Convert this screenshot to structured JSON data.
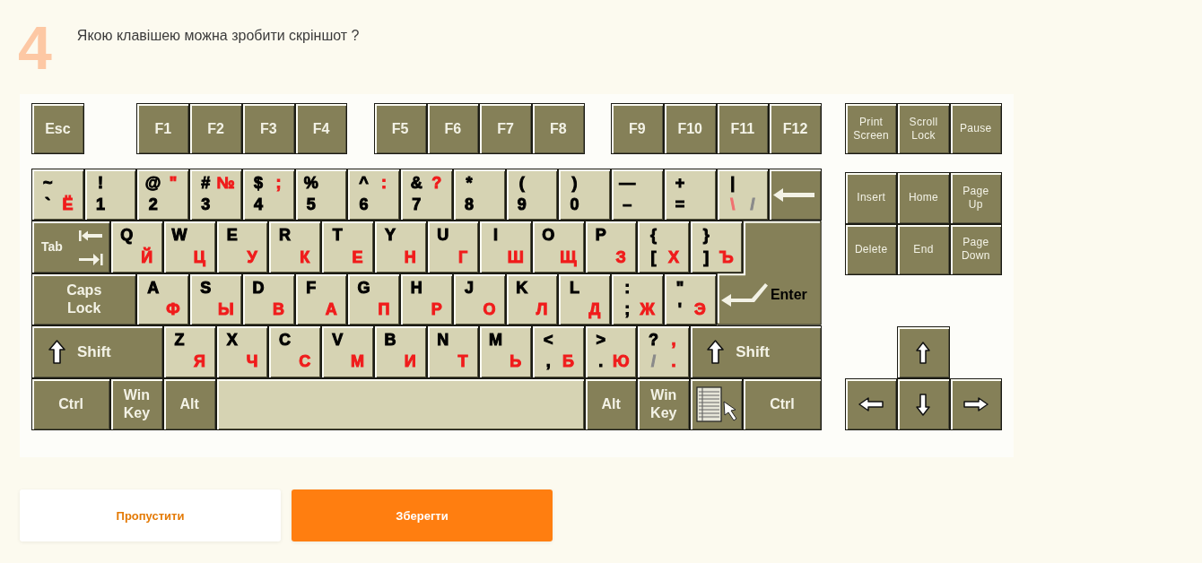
{
  "question": {
    "number": "4",
    "text": "Якою клавішею можна зробити скріншот ?"
  },
  "keyboard": {
    "function_groups": [
      {
        "keys": [
          {
            "kind": "label",
            "label": "Esc"
          }
        ]
      },
      {
        "keys": [
          {
            "kind": "label",
            "label": "F1"
          },
          {
            "kind": "label",
            "label": "F2"
          },
          {
            "kind": "label",
            "label": "F3"
          },
          {
            "kind": "label",
            "label": "F4"
          }
        ]
      },
      {
        "keys": [
          {
            "kind": "label",
            "label": "F5"
          },
          {
            "kind": "label",
            "label": "F6"
          },
          {
            "kind": "label",
            "label": "F7"
          },
          {
            "kind": "label",
            "label": "F8"
          }
        ]
      },
      {
        "keys": [
          {
            "kind": "label",
            "label": "F9"
          },
          {
            "kind": "label",
            "label": "F10"
          },
          {
            "kind": "label",
            "label": "F11"
          },
          {
            "kind": "label",
            "label": "F12"
          }
        ]
      }
    ],
    "rows": [
      {
        "keys": [
          {
            "kind": "char",
            "top_left": {
              "text": "~",
              "color": "#000000"
            },
            "bottom_left": {
              "text": "`",
              "color": "#000000"
            },
            "bottom_right": {
              "text": "Ё",
              "color": "#f01c1c"
            }
          },
          {
            "kind": "char",
            "top_left": {
              "text": "!",
              "color": "#000000"
            },
            "bottom_left": {
              "text": "1",
              "color": "#000000"
            }
          },
          {
            "kind": "char",
            "top_left": {
              "text": "@",
              "color": "#000000"
            },
            "bottom_left": {
              "text": "2",
              "color": "#000000"
            },
            "top_right": {
              "text": "\"",
              "color": "#f01c1c"
            }
          },
          {
            "kind": "char",
            "top_left": {
              "text": "#",
              "color": "#000000"
            },
            "bottom_left": {
              "text": "3",
              "color": "#000000"
            },
            "top_right": {
              "text": "№",
              "color": "#f01c1c"
            }
          },
          {
            "kind": "char",
            "top_left": {
              "text": "$",
              "color": "#000000"
            },
            "bottom_left": {
              "text": "4",
              "color": "#000000"
            },
            "top_right": {
              "text": ";",
              "color": "#f01c1c"
            }
          },
          {
            "kind": "char",
            "top_left": {
              "text": "%",
              "color": "#000000"
            },
            "bottom_left": {
              "text": "5",
              "color": "#000000"
            }
          },
          {
            "kind": "char",
            "top_left": {
              "text": "^",
              "color": "#000000"
            },
            "bottom_left": {
              "text": "6",
              "color": "#000000"
            },
            "top_right": {
              "text": ":",
              "color": "#f01c1c"
            }
          },
          {
            "kind": "char",
            "top_left": {
              "text": "&",
              "color": "#000000"
            },
            "bottom_left": {
              "text": "7",
              "color": "#000000"
            },
            "top_right": {
              "text": "?",
              "color": "#f01c1c"
            }
          },
          {
            "kind": "char",
            "top_left": {
              "text": "*",
              "color": "#000000"
            },
            "bottom_left": {
              "text": "8",
              "color": "#000000"
            }
          },
          {
            "kind": "char",
            "top_left": {
              "text": "(",
              "color": "#000000"
            },
            "bottom_left": {
              "text": "9",
              "color": "#000000"
            }
          },
          {
            "kind": "char",
            "top_left": {
              "text": ")",
              "color": "#000000"
            },
            "bottom_left": {
              "text": "0",
              "color": "#000000"
            }
          },
          {
            "kind": "char",
            "top_left": {
              "text": "—",
              "color": "#000000"
            },
            "bottom_left": {
              "text": "–",
              "color": "#000000"
            }
          },
          {
            "kind": "char",
            "top_left": {
              "text": "+",
              "color": "#000000"
            },
            "bottom_left": {
              "text": "=",
              "color": "#000000"
            }
          },
          {
            "kind": "char",
            "top_left": {
              "text": "|",
              "color": "#000000"
            },
            "bottom_left": {
              "text": "\\",
              "color": "#f07070"
            },
            "bottom_right": {
              "text": "/",
              "color": "#8a8a8a"
            }
          },
          {
            "kind": "backspace"
          }
        ]
      },
      {
        "keys": [
          {
            "kind": "tab",
            "label": "Tab"
          },
          {
            "kind": "char",
            "top_left": {
              "text": "Q",
              "color": "#000000"
            },
            "bottom_right": {
              "text": "Й",
              "color": "#f01c1c"
            }
          },
          {
            "kind": "char",
            "top_left": {
              "text": "W",
              "color": "#000000"
            },
            "bottom_right": {
              "text": "Ц",
              "color": "#f01c1c"
            }
          },
          {
            "kind": "char",
            "top_left": {
              "text": "E",
              "color": "#000000"
            },
            "bottom_right": {
              "text": "У",
              "color": "#f01c1c"
            }
          },
          {
            "kind": "char",
            "top_left": {
              "text": "R",
              "color": "#000000"
            },
            "bottom_right": {
              "text": "К",
              "color": "#f01c1c"
            }
          },
          {
            "kind": "char",
            "top_left": {
              "text": "T",
              "color": "#000000"
            },
            "bottom_right": {
              "text": "Е",
              "color": "#f01c1c"
            }
          },
          {
            "kind": "char",
            "top_left": {
              "text": "Y",
              "color": "#000000"
            },
            "bottom_right": {
              "text": "Н",
              "color": "#f01c1c"
            }
          },
          {
            "kind": "char",
            "top_left": {
              "text": "U",
              "color": "#000000"
            },
            "bottom_right": {
              "text": "Г",
              "color": "#f01c1c"
            }
          },
          {
            "kind": "char",
            "top_left": {
              "text": "I",
              "color": "#000000"
            },
            "bottom_right": {
              "text": "Ш",
              "color": "#f01c1c"
            }
          },
          {
            "kind": "char",
            "top_left": {
              "text": "O",
              "color": "#000000"
            },
            "bottom_right": {
              "text": "Щ",
              "color": "#f01c1c"
            }
          },
          {
            "kind": "char",
            "top_left": {
              "text": "P",
              "color": "#000000"
            },
            "bottom_right": {
              "text": "З",
              "color": "#f01c1c"
            }
          },
          {
            "kind": "char",
            "top_left": {
              "text": "{",
              "color": "#000000"
            },
            "bottom_left": {
              "text": "[",
              "color": "#000000"
            },
            "bottom_right": {
              "text": "Х",
              "color": "#f01c1c"
            }
          },
          {
            "kind": "char",
            "top_left": {
              "text": "}",
              "color": "#000000"
            },
            "bottom_left": {
              "text": "]",
              "color": "#000000"
            },
            "bottom_right": {
              "text": "Ъ",
              "color": "#f01c1c"
            }
          },
          {
            "kind": "enter",
            "label": "Enter"
          }
        ]
      },
      {
        "keys": [
          {
            "kind": "label",
            "label": "Caps Lock"
          },
          {
            "kind": "char",
            "top_left": {
              "text": "A",
              "color": "#000000"
            },
            "bottom_right": {
              "text": "Ф",
              "color": "#f01c1c"
            }
          },
          {
            "kind": "char",
            "top_left": {
              "text": "S",
              "color": "#000000"
            },
            "bottom_right": {
              "text": "Ы",
              "color": "#f01c1c"
            }
          },
          {
            "kind": "char",
            "top_left": {
              "text": "D",
              "color": "#000000"
            },
            "bottom_right": {
              "text": "В",
              "color": "#f01c1c"
            }
          },
          {
            "kind": "char",
            "top_left": {
              "text": "F",
              "color": "#000000"
            },
            "bottom_right": {
              "text": "А",
              "color": "#f01c1c"
            }
          },
          {
            "kind": "char",
            "top_left": {
              "text": "G",
              "color": "#000000"
            },
            "bottom_right": {
              "text": "П",
              "color": "#f01c1c"
            }
          },
          {
            "kind": "char",
            "top_left": {
              "text": "H",
              "color": "#000000"
            },
            "bottom_right": {
              "text": "Р",
              "color": "#f01c1c"
            }
          },
          {
            "kind": "char",
            "top_left": {
              "text": "J",
              "color": "#000000"
            },
            "bottom_right": {
              "text": "О",
              "color": "#f01c1c"
            }
          },
          {
            "kind": "char",
            "top_left": {
              "text": "K",
              "color": "#000000"
            },
            "bottom_right": {
              "text": "Л",
              "color": "#f01c1c"
            }
          },
          {
            "kind": "char",
            "top_left": {
              "text": "L",
              "color": "#000000"
            },
            "bottom_right": {
              "text": "Д",
              "color": "#f01c1c"
            }
          },
          {
            "kind": "char",
            "top_left": {
              "text": ":",
              "color": "#000000"
            },
            "bottom_left": {
              "text": ";",
              "color": "#000000"
            },
            "bottom_right": {
              "text": "Ж",
              "color": "#f01c1c"
            }
          },
          {
            "kind": "char",
            "top_left": {
              "text": "\"",
              "color": "#000000"
            },
            "bottom_left": {
              "text": "'",
              "color": "#000000"
            },
            "bottom_right": {
              "text": "Э",
              "color": "#f01c1c"
            }
          }
        ]
      },
      {
        "keys": [
          {
            "kind": "shift",
            "label": "Shift"
          },
          {
            "kind": "char",
            "top_left": {
              "text": "Z",
              "color": "#000000"
            },
            "bottom_right": {
              "text": "Я",
              "color": "#f01c1c"
            }
          },
          {
            "kind": "char",
            "top_left": {
              "text": "X",
              "color": "#000000"
            },
            "bottom_right": {
              "text": "Ч",
              "color": "#f01c1c"
            }
          },
          {
            "kind": "char",
            "top_left": {
              "text": "C",
              "color": "#000000"
            },
            "bottom_right": {
              "text": "С",
              "color": "#f01c1c"
            }
          },
          {
            "kind": "char",
            "top_left": {
              "text": "V",
              "color": "#000000"
            },
            "bottom_right": {
              "text": "М",
              "color": "#f01c1c"
            }
          },
          {
            "kind": "char",
            "top_left": {
              "text": "B",
              "color": "#000000"
            },
            "bottom_right": {
              "text": "И",
              "color": "#f01c1c"
            }
          },
          {
            "kind": "char",
            "top_left": {
              "text": "N",
              "color": "#000000"
            },
            "bottom_right": {
              "text": "Т",
              "color": "#f01c1c"
            }
          },
          {
            "kind": "char",
            "top_left": {
              "text": "M",
              "color": "#000000"
            },
            "bottom_right": {
              "text": "Ь",
              "color": "#f01c1c"
            }
          },
          {
            "kind": "char",
            "top_left": {
              "text": "<",
              "color": "#000000"
            },
            "bottom_left": {
              "text": ",",
              "color": "#000000"
            },
            "bottom_right": {
              "text": "Б",
              "color": "#f01c1c"
            }
          },
          {
            "kind": "char",
            "top_left": {
              "text": ">",
              "color": "#000000"
            },
            "bottom_left": {
              "text": ".",
              "color": "#000000"
            },
            "bottom_right": {
              "text": "Ю",
              "color": "#f01c1c"
            }
          },
          {
            "kind": "char",
            "top_left": {
              "text": "?",
              "color": "#000000"
            },
            "bottom_left": {
              "text": "/",
              "color": "#8a8a8a"
            },
            "top_right": {
              "text": ",",
              "color": "#f01c1c"
            },
            "bottom_right": {
              "text": ".",
              "color": "#f01c1c"
            }
          },
          {
            "kind": "shift",
            "label": "Shift"
          }
        ]
      },
      {
        "keys": [
          {
            "kind": "label",
            "label": "Ctrl"
          },
          {
            "kind": "label",
            "label": "Win Key"
          },
          {
            "kind": "label",
            "label": "Alt"
          },
          {
            "kind": "space"
          },
          {
            "kind": "label",
            "label": "Alt"
          },
          {
            "kind": "label",
            "label": "Win Key"
          },
          {
            "kind": "menu"
          },
          {
            "kind": "label",
            "label": "Ctrl"
          }
        ]
      }
    ],
    "system_keys": [
      {
        "kind": "label",
        "label": "Print Screen"
      },
      {
        "kind": "label",
        "label": "Scroll Lock"
      },
      {
        "kind": "label",
        "label": "Pause"
      }
    ],
    "navigation_keys": [
      {
        "kind": "label",
        "label": "Insert"
      },
      {
        "kind": "label",
        "label": "Home"
      },
      {
        "kind": "label",
        "label": "Page Up"
      },
      {
        "kind": "label",
        "label": "Delete"
      },
      {
        "kind": "label",
        "label": "End"
      },
      {
        "kind": "label",
        "label": "Page Down"
      }
    ],
    "arrow_keys": [
      {
        "kind": "up"
      },
      {
        "kind": "left"
      },
      {
        "kind": "down"
      },
      {
        "kind": "right"
      }
    ]
  },
  "buttons": [
    {
      "label": "Пропустити",
      "kind": "secondary"
    },
    {
      "label": "Зберегти",
      "kind": "primary"
    }
  ]
}
